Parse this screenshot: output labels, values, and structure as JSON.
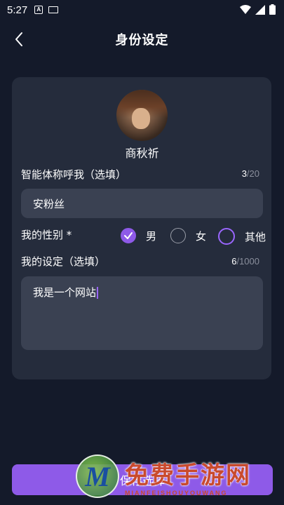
{
  "status_bar": {
    "time": "5:27",
    "notif_a": "A"
  },
  "header": {
    "title": "身份设定"
  },
  "character": {
    "name": "商秋祈"
  },
  "nickname": {
    "label": "智能体称呼我（选填）",
    "count_current": "3",
    "count_max": "/20",
    "value": "安粉丝"
  },
  "gender": {
    "label": "我的性别 *",
    "options": [
      {
        "label": "男",
        "selected": true
      },
      {
        "label": "女",
        "selected": false
      },
      {
        "label": "其他",
        "selected": false
      }
    ]
  },
  "persona": {
    "label": "我的设定（选填）",
    "count_current": "6",
    "count_max": "/1000",
    "value": "我是一个网站"
  },
  "save_button": {
    "label": "保存选择"
  },
  "watermark": {
    "logo_letter": "M",
    "title": "免费手游网",
    "subtitle": "MIANFEISHOUYOUWANG"
  },
  "colors": {
    "background": "#141a2a",
    "card": "#252c3c",
    "field": "#3a4152",
    "accent": "#8e5ae8"
  }
}
